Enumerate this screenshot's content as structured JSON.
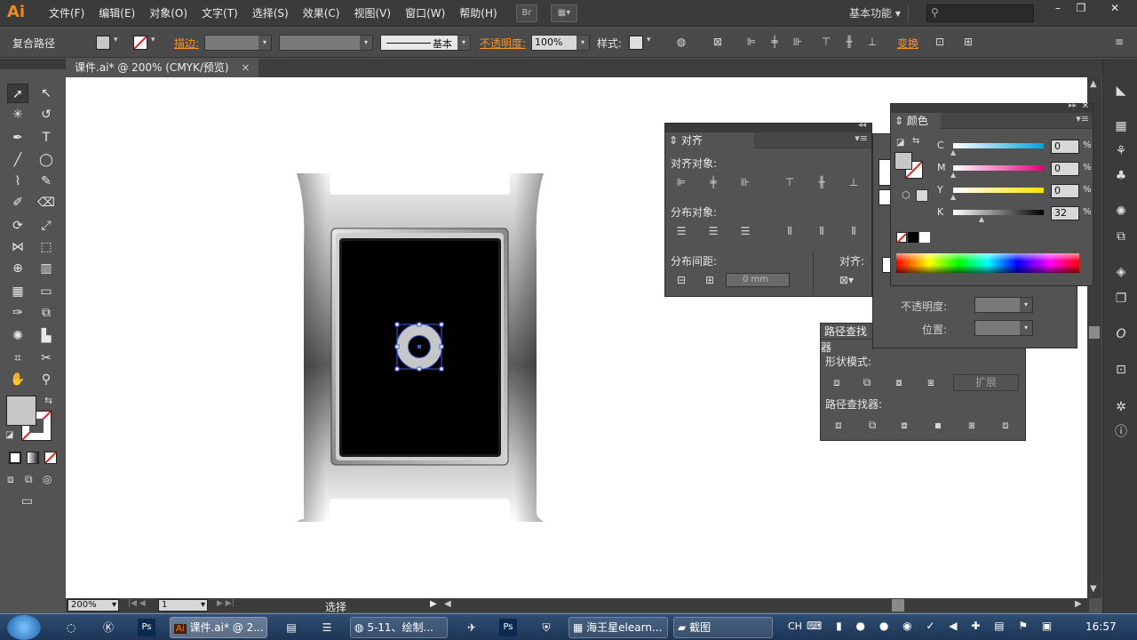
{
  "app": {
    "logo": "Ai"
  },
  "menu": [
    "文件(F)",
    "编辑(E)",
    "对象(O)",
    "文字(T)",
    "选择(S)",
    "效果(C)",
    "视图(V)",
    "窗口(W)",
    "帮助(H)"
  ],
  "titlebar": {
    "br_label": "Br",
    "workspace": "基本功能",
    "search_placeholder": ""
  },
  "control": {
    "selection_type": "复合路径",
    "stroke_label": "描边:",
    "stroke_style": "基本",
    "opacity_label": "不透明度:",
    "opacity_value": "100%",
    "style_label": "样式:",
    "transform_label": "变换"
  },
  "document": {
    "tab_title": "课件.ai* @ 200% (CMYK/预览)",
    "close_glyph": "×"
  },
  "status": {
    "zoom": "200%",
    "artboard": "1",
    "tool_status": "选择"
  },
  "align_panel": {
    "title": "对齐",
    "align_objects": "对齐对象:",
    "distribute_objects": "分布对象:",
    "distribute_spacing": "分布间距:",
    "align_to": "对齐:",
    "spacing_value": "0 mm"
  },
  "color_panel": {
    "title": "颜色",
    "channels": [
      {
        "name": "C",
        "value": "0"
      },
      {
        "name": "M",
        "value": "0"
      },
      {
        "name": "Y",
        "value": "0"
      },
      {
        "name": "K",
        "value": "32"
      }
    ],
    "percent": "%",
    "fill_gray": "#c7c7c7"
  },
  "transparency_panel": {
    "opacity_label": "不透明度:",
    "position_label": "位置:"
  },
  "pathfinder_panel": {
    "title": "路径查找器",
    "shape_modes": "形状模式:",
    "expand_label": "扩展",
    "pathfinders": "路径查找器:"
  },
  "taskbar": {
    "items": [
      "课件.ai* @ 2...",
      "5-11、绘制...",
      "海王星elearn...",
      "截图"
    ],
    "tray_lang": "CH",
    "clock": "16:57"
  },
  "colors": {
    "accent": "#f5922e",
    "selection": "#3b5bdb"
  }
}
